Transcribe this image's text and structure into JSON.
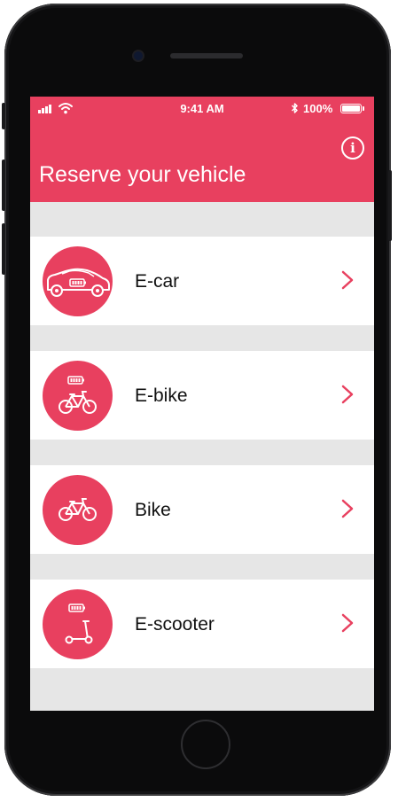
{
  "status_bar": {
    "time": "9:41 AM",
    "battery": "100%"
  },
  "header": {
    "title": "Reserve your vehicle",
    "info_label": "i"
  },
  "vehicles": [
    {
      "label": "E-car",
      "icon": "e-car-icon"
    },
    {
      "label": "E-bike",
      "icon": "e-bike-icon"
    },
    {
      "label": "Bike",
      "icon": "bike-icon"
    },
    {
      "label": "E-scooter",
      "icon": "e-scooter-icon"
    }
  ],
  "colors": {
    "accent": "#e8405f",
    "background": "#e6e6e6",
    "row": "#ffffff"
  }
}
